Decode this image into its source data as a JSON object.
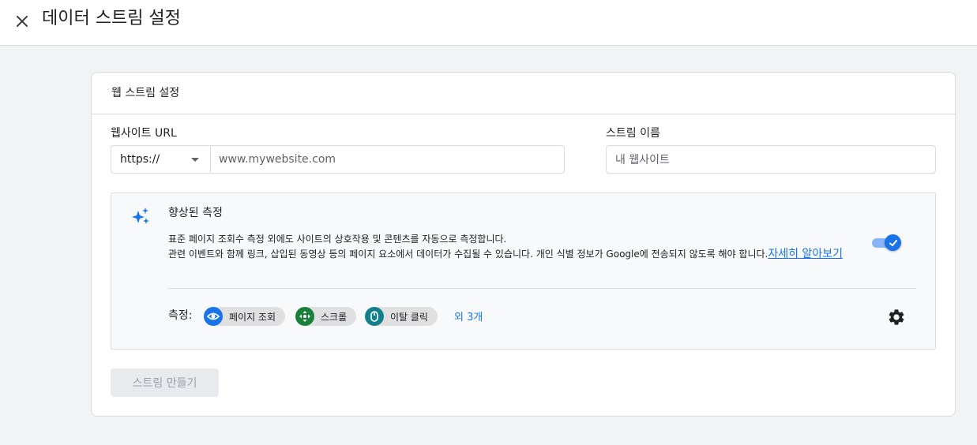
{
  "header": {
    "title": "데이터 스트림 설정"
  },
  "card": {
    "title": "웹 스트림 설정",
    "website_url": {
      "label": "웹사이트 URL",
      "protocol": "https://",
      "placeholder": "www.mywebsite.com"
    },
    "stream_name": {
      "label": "스트림 이름",
      "placeholder": "내 웹사이트"
    },
    "enhanced_measurement": {
      "title": "향상된 측정",
      "description_line1": "표준 페이지 조회수 측정 외에도 사이트의 상호작용 및 콘텐츠를 자동으로 측정합니다.",
      "description_line2": "관련 이벤트와 함께 링크, 삽입된 동영상 등의 페이지 요소에서 데이터가 수집될 수 있습니다. 개인 식별 정보가 Google에 전송되지 않도록 해야 합니다.",
      "learn_more": "자세히 알아보기",
      "toggle_on": true,
      "measure_label": "측정:",
      "chips": [
        {
          "label": "페이지 조회",
          "icon": "eye-icon",
          "color": "#1a73e8"
        },
        {
          "label": "스크롤",
          "icon": "scroll-crosshair-icon",
          "color": "#188038"
        },
        {
          "label": "이탈 클릭",
          "icon": "mouse-icon",
          "color": "#12808a"
        }
      ],
      "more_link": "외 3개"
    },
    "create_button": "스트림 만들기"
  },
  "colors": {
    "accent": "#1a73e8",
    "toggle_track": "#8ab4f8",
    "border": "#dadce0",
    "page_bg": "#f1f3f4"
  }
}
